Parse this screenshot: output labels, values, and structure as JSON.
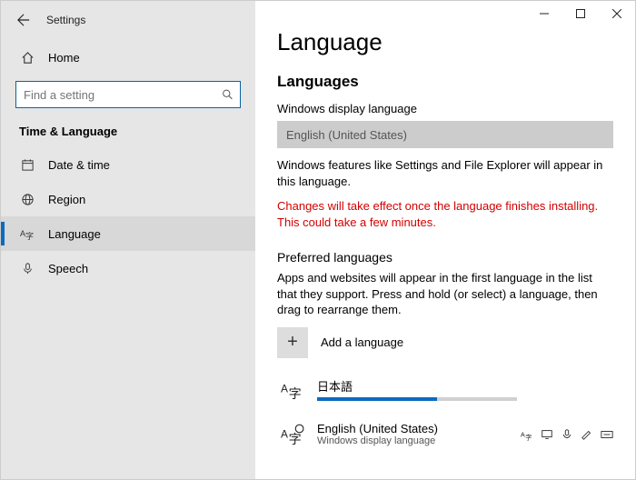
{
  "window": {
    "title": "Settings"
  },
  "sidebar": {
    "home": "Home",
    "search_placeholder": "Find a setting",
    "section": "Time & Language",
    "items": [
      {
        "label": "Date & time"
      },
      {
        "label": "Region"
      },
      {
        "label": "Language"
      },
      {
        "label": "Speech"
      }
    ]
  },
  "page": {
    "title": "Language",
    "languages_hdr": "Languages",
    "display_label": "Windows display language",
    "display_value": "English (United States)",
    "display_desc": "Windows features like Settings and File Explorer will appear in this language.",
    "display_warn": "Changes will take effect once the language finishes installing. This could take a few minutes.",
    "preferred_hdr": "Preferred languages",
    "preferred_desc": "Apps and websites will appear in the first language in the list that they support. Press and hold (or select) a language, then drag to rearrange them.",
    "add_label": "Add a language",
    "langs": [
      {
        "name": "日本語",
        "installing": true
      },
      {
        "name": "English (United States)",
        "sub": "Windows display language"
      }
    ]
  }
}
